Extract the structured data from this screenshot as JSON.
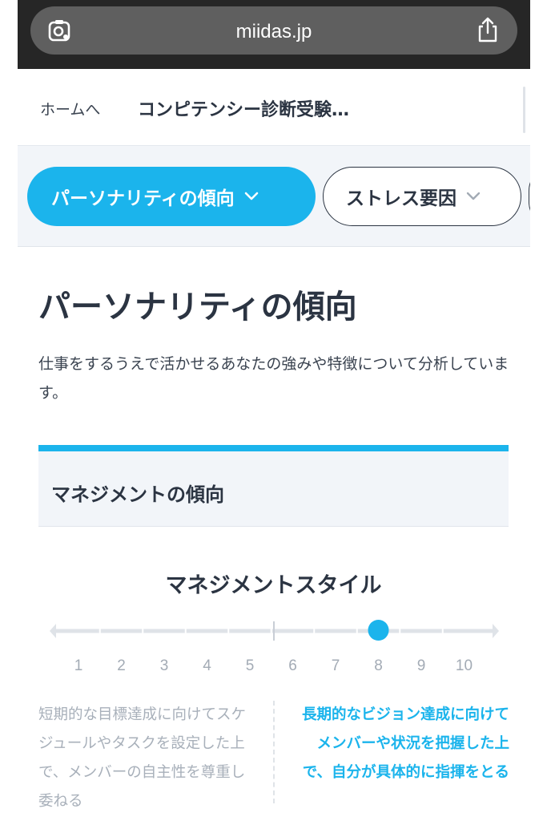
{
  "browser": {
    "url": "miidas.jp",
    "lens_icon": "camera-lens-icon",
    "share_icon": "share-icon"
  },
  "breadcrumb": {
    "home": "ホームへ",
    "current": "コンピテンシー診断受験…"
  },
  "filters": {
    "active": "パーソナリティの傾向",
    "second": "ストレス要因",
    "chevron_icon": "chevron-down-icon"
  },
  "page": {
    "title": "パーソナリティの傾向",
    "description": "仕事をするうえで活かせるあなたの強みや特徴について分析しています。"
  },
  "section": {
    "title": "マネジメントの傾向"
  },
  "scale": {
    "title": "マネジメントスタイル",
    "labels": [
      "1",
      "2",
      "3",
      "4",
      "5",
      "6",
      "7",
      "8",
      "9",
      "10"
    ],
    "selected": 8,
    "left_text": "短期的な目標達成に向けてスケジュールやタスクを設定した上で、メンバーの自主性を尊重し委ねる",
    "right_text": "長期的なビジョン達成に向けてメンバーや状況を把握した上で、自分が具体的に指揮をとる"
  },
  "colors": {
    "accent": "#1bb4ec",
    "text": "#2b3442",
    "muted": "#a8b0ba",
    "band": "#f2f5f9"
  }
}
